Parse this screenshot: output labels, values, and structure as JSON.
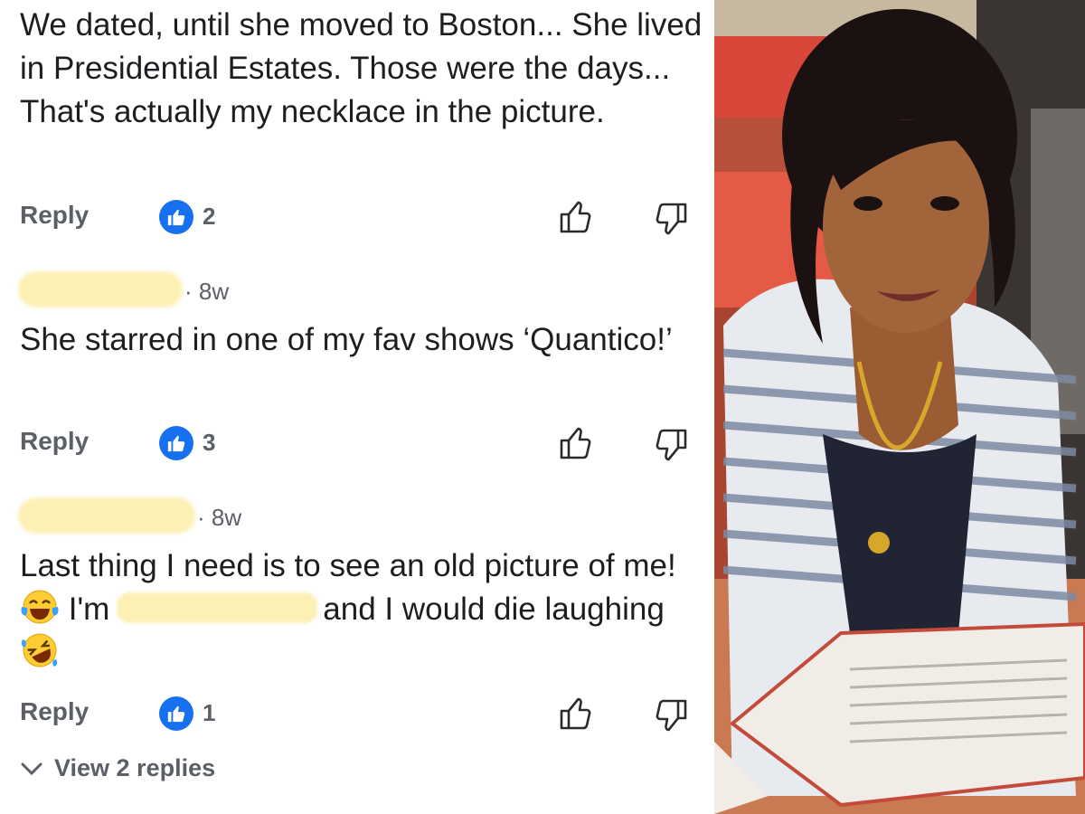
{
  "comments": [
    {
      "text": "We dated, until she moved to Boston... She lived in Presidential Estates. Those were the days... That's actually my necklace in the picture.",
      "reply_label": "Reply",
      "likes": "2"
    },
    {
      "age": "· 8w",
      "text": "She starred in one of my fav shows ‘Quantico!’",
      "reply_label": "Reply",
      "likes": "3"
    },
    {
      "age": "· 8w",
      "text_part1": "Last thing I need is to see an old picture of me!",
      "text_part2": "I'm",
      "text_part3": "and I would die laughing",
      "reply_label": "Reply",
      "likes": "1"
    }
  ],
  "view_replies_label": "View 2 replies",
  "icons": {
    "like_badge": "thumbs-up-icon",
    "upvote": "thumbs-up-outline-icon",
    "downvote": "thumbs-down-outline-icon",
    "laugh_emoji_1": "tears-of-joy-emoji",
    "laugh_emoji_2": "rolling-laughing-emoji",
    "expand": "chevron-down-icon"
  },
  "colors": {
    "like_badge": "#1670f0",
    "redaction": "#fdf0b5",
    "secondary_text": "#5b5f66"
  }
}
